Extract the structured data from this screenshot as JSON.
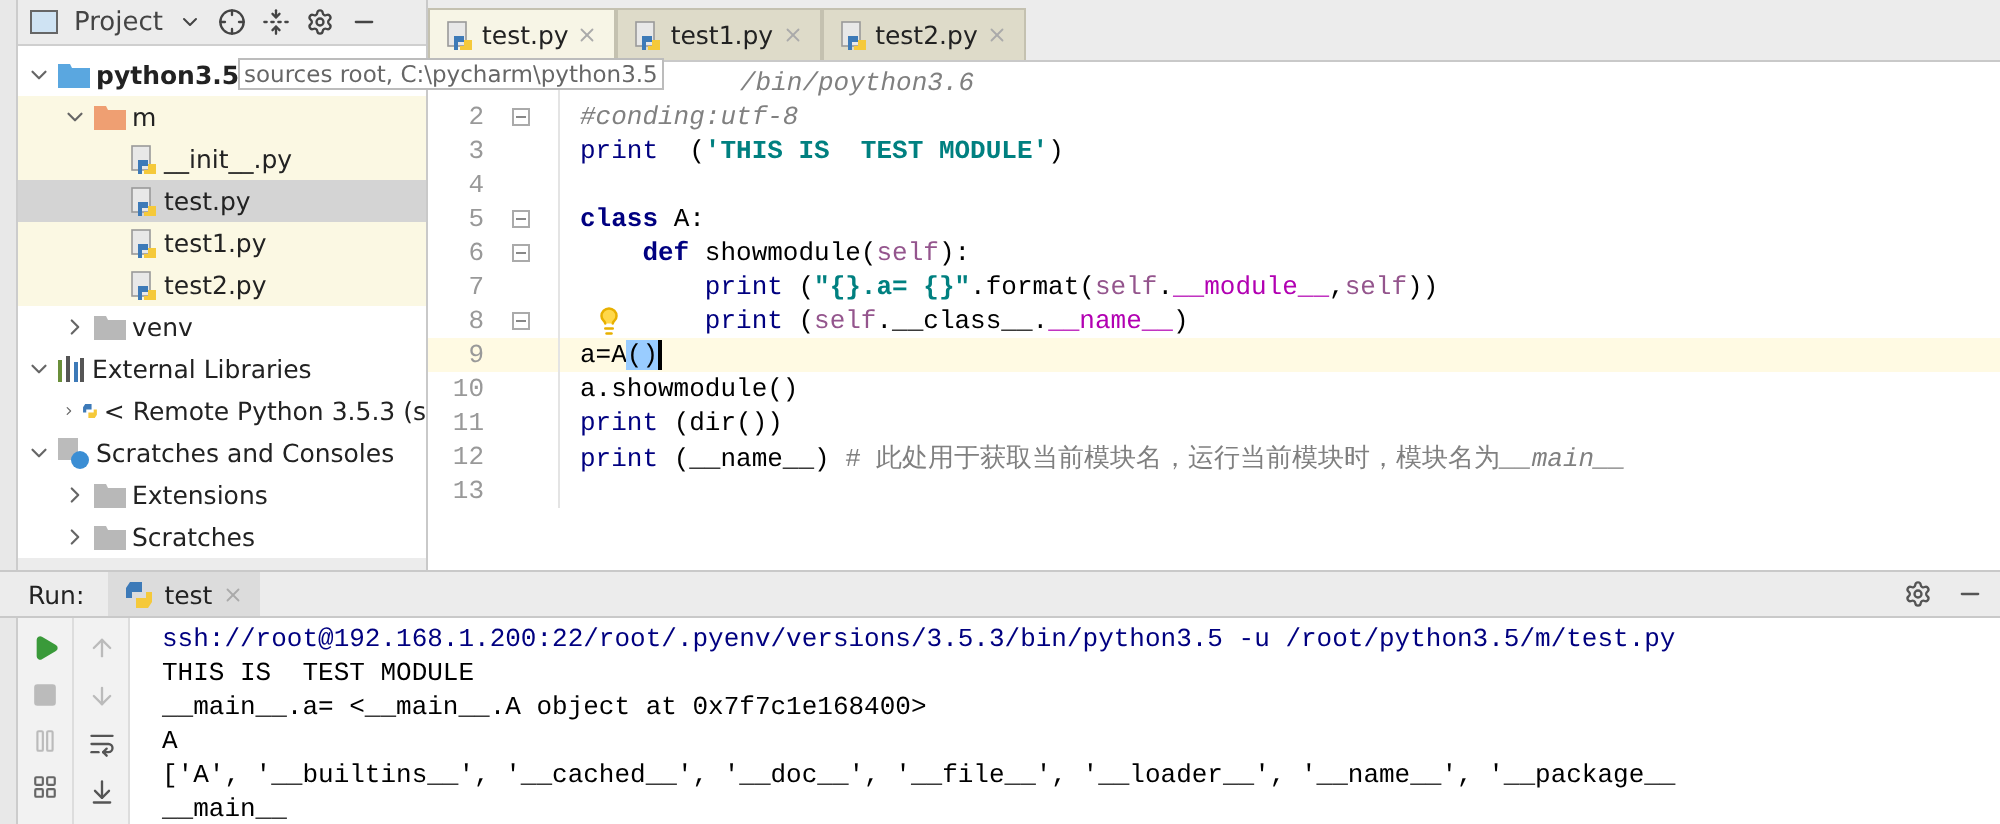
{
  "project_panel": {
    "title": "Project",
    "tree": [
      {
        "name": "python3.5",
        "kind": "source-folder",
        "detail": "sources root, C:\\pycharm\\python3.5",
        "expanded": true,
        "selected": false,
        "highlighted": false,
        "children": [
          {
            "name": "m",
            "kind": "package-folder",
            "expanded": true,
            "selected": false,
            "highlighted": true,
            "children": [
              {
                "name": "__init__.py",
                "kind": "python-file",
                "selected": false,
                "highlighted": true
              },
              {
                "name": "test.py",
                "kind": "python-file",
                "selected": true,
                "highlighted": true
              },
              {
                "name": "test1.py",
                "kind": "python-file",
                "selected": false,
                "highlighted": true
              },
              {
                "name": "test2.py",
                "kind": "python-file",
                "selected": false,
                "highlighted": true
              }
            ]
          },
          {
            "name": "venv",
            "kind": "folder",
            "expanded": false,
            "selected": false,
            "highlighted": false
          }
        ]
      },
      {
        "name": "External Libraries",
        "kind": "library",
        "expanded": true,
        "selected": false,
        "highlighted": false,
        "children": [
          {
            "name": "< Remote Python 3.5.3 (s",
            "kind": "python-sdk",
            "expanded": false,
            "selected": false,
            "highlighted": false
          }
        ]
      },
      {
        "name": "Scratches and Consoles",
        "kind": "scratches",
        "expanded": true,
        "selected": false,
        "highlighted": false,
        "children": [
          {
            "name": "Extensions",
            "kind": "folder",
            "expanded": false,
            "selected": false,
            "highlighted": false
          },
          {
            "name": "Scratches",
            "kind": "folder",
            "expanded": false,
            "selected": false,
            "highlighted": false
          }
        ]
      }
    ]
  },
  "editor": {
    "tabs": [
      {
        "label": "test.py",
        "selected": true
      },
      {
        "label": "test1.py",
        "selected": false
      },
      {
        "label": "test2.py",
        "selected": false
      }
    ],
    "lines": [
      {
        "fold": false,
        "current": false,
        "tokens": [
          {
            "kind": "comment",
            "text": "/bin/poython3.6"
          }
        ]
      },
      {
        "number": "2",
        "fold": true,
        "current": false,
        "tokens": [
          {
            "kind": "comment",
            "text": "#conding:utf-8"
          }
        ]
      },
      {
        "number": "3",
        "fold": false,
        "current": false,
        "tokens": [
          {
            "kind": "builtin",
            "text": "print"
          },
          {
            "kind": "plain",
            "text": "  ("
          },
          {
            "kind": "string",
            "text": "'THIS IS  TEST MODULE'"
          },
          {
            "kind": "plain",
            "text": ")"
          }
        ]
      },
      {
        "number": "4",
        "fold": false,
        "current": false
      },
      {
        "number": "5",
        "fold": true,
        "current": false,
        "tokens": [
          {
            "kind": "keyword",
            "text": "class"
          },
          {
            "kind": "plain",
            "text": " A:"
          }
        ]
      },
      {
        "number": "6",
        "fold": true,
        "current": false,
        "tokens": [
          {
            "kind": "keyword",
            "text": "    def"
          },
          {
            "kind": "plain",
            "text": " showmodule("
          },
          {
            "kind": "self",
            "text": "self"
          },
          {
            "kind": "plain",
            "text": "):"
          }
        ]
      },
      {
        "number": "7",
        "fold": false,
        "current": false,
        "tokens": [
          {
            "kind": "builtin",
            "text": "        print"
          },
          {
            "kind": "plain",
            "text": " ("
          },
          {
            "kind": "string",
            "text": "\"{}.a= {}\""
          },
          {
            "kind": "plain",
            "text": ".format("
          },
          {
            "kind": "self",
            "text": "self"
          },
          {
            "kind": "plain",
            "text": "."
          },
          {
            "kind": "magic",
            "text": "__module__"
          },
          {
            "kind": "plain",
            "text": ","
          },
          {
            "kind": "self",
            "text": "self"
          },
          {
            "kind": "plain",
            "text": "))"
          }
        ]
      },
      {
        "number": "8",
        "fold": true,
        "current": false,
        "bulb": true,
        "tokens": [
          {
            "kind": "builtin",
            "text": "        print"
          },
          {
            "kind": "plain",
            "text": " ("
          },
          {
            "kind": "self",
            "text": "self"
          },
          {
            "kind": "plain",
            "text": ".__class__."
          },
          {
            "kind": "magic",
            "text": "__name__"
          },
          {
            "kind": "plain",
            "text": ")"
          }
        ]
      },
      {
        "number": "9",
        "fold": false,
        "current": true,
        "tokens": [
          {
            "kind": "plain",
            "text": "a=A"
          },
          {
            "kind": "match",
            "text": "()"
          }
        ]
      },
      {
        "number": "10",
        "fold": false,
        "current": false,
        "tokens": [
          {
            "kind": "plain",
            "text": "a.showmodule()"
          }
        ]
      },
      {
        "number": "11",
        "fold": false,
        "current": false,
        "tokens": [
          {
            "kind": "builtin",
            "text": "print"
          },
          {
            "kind": "plain",
            "text": " (dir())"
          }
        ]
      },
      {
        "number": "12",
        "fold": false,
        "current": false,
        "tokens": [
          {
            "kind": "builtin",
            "text": "print"
          },
          {
            "kind": "plain",
            "text": " (__name__) "
          },
          {
            "kind": "note",
            "text": "# 此处用于获取当前模块名，运行当前模块时，模块名为"
          },
          {
            "kind": "comment",
            "text": "__main__"
          }
        ]
      },
      {
        "number": "13",
        "fold": false,
        "current": false
      }
    ]
  },
  "run_panel": {
    "label": "Run:",
    "tab": "test",
    "output": [
      {
        "kind": "command",
        "text": "ssh://root@192.168.1.200:22/root/.pyenv/versions/3.5.3/bin/python3.5 -u /root/python3.5/m/test.py"
      },
      {
        "kind": "output",
        "text": "THIS IS  TEST MODULE"
      },
      {
        "kind": "output",
        "text": "__main__.a= <__main__.A object at 0x7f7c1e168400>"
      },
      {
        "kind": "output",
        "text": "A"
      },
      {
        "kind": "output",
        "text": "['A', '__builtins__', '__cached__', '__doc__', '__file__', '__loader__', '__name__', '__package__"
      },
      {
        "kind": "output",
        "text": "__main__"
      }
    ]
  }
}
